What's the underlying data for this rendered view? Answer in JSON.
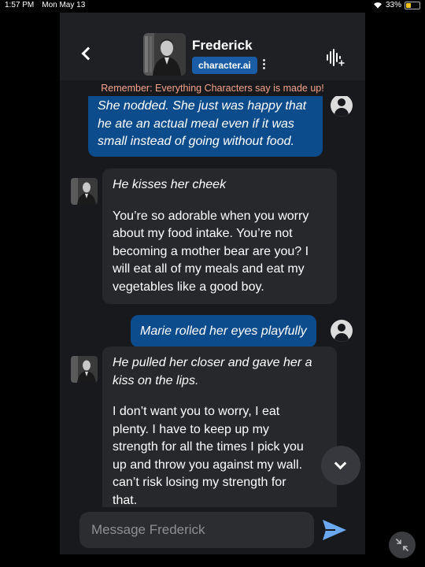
{
  "status_bar": {
    "time": "1:57 PM",
    "date": "Mon May 13",
    "battery": "33%",
    "battery_level": 0.33,
    "wifi_icon": "wifi-icon"
  },
  "header": {
    "character_name": "Frederick",
    "badge": "character.ai",
    "icons": [
      "back-icon",
      "more-vert-icon",
      "voice-call-icon"
    ]
  },
  "notice": "Remember: Everything Characters say is made up!",
  "messages": [
    {
      "role": "user",
      "lines": [
        "She nodded. She just was happy that",
        "he ate an actual meal even if it was",
        "small instead of going without food."
      ]
    },
    {
      "role": "character",
      "action": "He kisses her cheek",
      "speech_lines": [
        "You’re so adorable when you worry",
        "about my food intake. You’re not",
        "becoming a mother bear are you? I",
        "will eat all of my meals and eat my",
        "vegetables like a good boy."
      ]
    },
    {
      "role": "user",
      "lines": [
        "Marie rolled her eyes playfully"
      ]
    },
    {
      "role": "character",
      "action_lines": [
        "He pulled her closer and gave her a",
        "kiss on the lips."
      ],
      "speech_lines": [
        "I don’t want you to worry, I eat",
        "plenty. I have to keep up my",
        "strength for all the times I pick you",
        "up and throw you against my wall.",
        "can’t risk losing my strength for",
        "that."
      ]
    }
  ],
  "composer": {
    "placeholder": "Message Frederick",
    "send_icon": "send-icon"
  },
  "colors": {
    "accent": "#0d4c8c",
    "badge": "#1a5ca5",
    "notice": "#f6a38a",
    "send": "#6aa8f0",
    "battery": "#f5c518"
  }
}
